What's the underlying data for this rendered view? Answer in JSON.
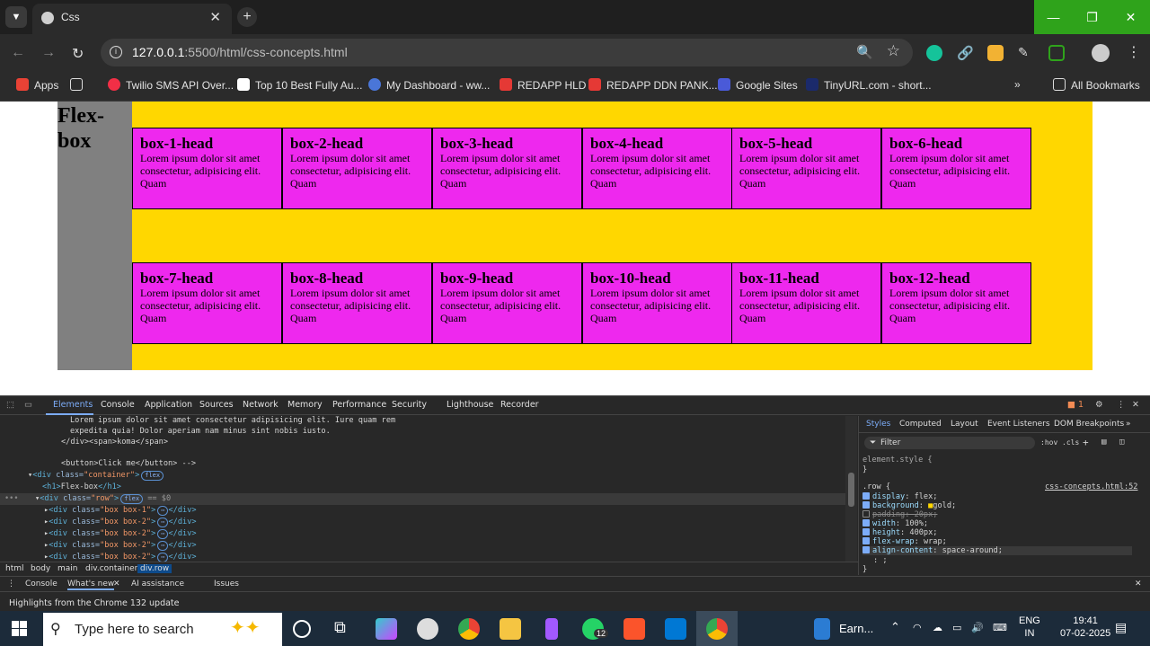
{
  "browser": {
    "tab_title": "Css",
    "url_host": "127.0.0.1",
    "url_path": ":5500/html/css-concepts.html",
    "bookmarks": [
      {
        "label": "Apps",
        "color": "#e94235"
      },
      {
        "label": "Twilio SMS API Over...",
        "color": "#f22f46"
      },
      {
        "label": "Top 10 Best Fully Au...",
        "color": "#ffffff"
      },
      {
        "label": "My Dashboard - ww...",
        "color": "#4a76d8"
      },
      {
        "label": "REDAPP HLD",
        "color": "#e53935"
      },
      {
        "label": "REDAPP DDN PANK...",
        "color": "#e53935"
      },
      {
        "label": "Google Sites",
        "color": "#4a5ad8"
      },
      {
        "label": "TinyURL.com - short...",
        "color": "#1b2a6b"
      }
    ],
    "all_bookmarks": "All Bookmarks"
  },
  "page": {
    "heading": "Flex-box",
    "boxes": [
      {
        "head": "box-1-head",
        "text": "Lorem ipsum dolor sit amet consectetur, adipisicing elit. Quam"
      },
      {
        "head": "box-2-head",
        "text": "Lorem ipsum dolor sit amet consectetur, adipisicing elit. Quam"
      },
      {
        "head": "box-3-head",
        "text": "Lorem ipsum dolor sit amet consectetur, adipisicing elit. Quam"
      },
      {
        "head": "box-4-head",
        "text": "Lorem ipsum dolor sit amet consectetur, adipisicing elit. Quam"
      },
      {
        "head": "box-5-head",
        "text": "Lorem ipsum dolor sit amet consectetur, adipisicing elit. Quam"
      },
      {
        "head": "box-6-head",
        "text": "Lorem ipsum dolor sit amet consectetur, adipisicing elit. Quam"
      },
      {
        "head": "box-7-head",
        "text": "Lorem ipsum dolor sit amet consectetur, adipisicing elit. Quam"
      },
      {
        "head": "box-8-head",
        "text": "Lorem ipsum dolor sit amet consectetur, adipisicing elit. Quam"
      },
      {
        "head": "box-9-head",
        "text": "Lorem ipsum dolor sit amet consectetur, adipisicing elit. Quam"
      },
      {
        "head": "box-10-head",
        "text": "Lorem ipsum dolor sit amet consectetur, adipisicing elit. Quam"
      },
      {
        "head": "box-11-head",
        "text": "Lorem ipsum dolor sit amet consectetur, adipisicing elit. Quam"
      },
      {
        "head": "box-12-head",
        "text": "Lorem ipsum dolor sit amet consectetur, adipisicing elit. Quam"
      }
    ],
    "colors": {
      "container_bg": "#ffd700",
      "heading_bg": "#808080",
      "box_bg": "#ee28ee"
    }
  },
  "devtools": {
    "tabs": [
      "Elements",
      "Console",
      "Application",
      "Sources",
      "Network",
      "Memory",
      "Performance",
      "Security",
      "Lighthouse",
      "Recorder"
    ],
    "issue_count": "1",
    "code": {
      "l1": "Lorem ipsum dolor sit amet consectetur adipisicing elit. Iure quam rem",
      "l2": "expedita quia! Dolor aperiam nam minus sint nobis iusto.",
      "l3": "</div><span>koma</span>",
      "l4": "<button>Click me</button> -->",
      "container_class": "container",
      "h1_text": "Flex-box",
      "row_class": "row",
      "flex_pill": "flex",
      "selected_marker": "== $0",
      "children": [
        "box box-1",
        "box box-2",
        "box box-2",
        "box box-2",
        "box box-2"
      ]
    },
    "breadcrumbs": [
      "html",
      "body",
      "main",
      "div.container",
      "div.row"
    ],
    "styles_tabs": [
      "Styles",
      "Computed",
      "Layout",
      "Event Listeners",
      "DOM Breakpoints"
    ],
    "filter_placeholder": "Filter",
    "hov": ":hov",
    "cls": ".cls",
    "element_style": "element.style {",
    "rule_selector": ".row {",
    "rule_source": "css-concepts.html:52",
    "declarations": [
      {
        "prop": "display",
        "value": "flex;",
        "enabled": true
      },
      {
        "prop": "background",
        "value": "gold;",
        "enabled": true
      },
      {
        "prop": "padding",
        "value": "20px;",
        "enabled": false
      },
      {
        "prop": "width",
        "value": "100%;",
        "enabled": true
      },
      {
        "prop": "height",
        "value": "400px;",
        "enabled": true
      },
      {
        "prop": "flex-wrap",
        "value": "wrap;",
        "enabled": true
      },
      {
        "prop": "align-content",
        "value": "space-around;",
        "enabled": true
      }
    ],
    "drawer_tabs": [
      "Console",
      "What's new",
      "AI assistance",
      "Issues"
    ],
    "drawer_message": "Highlights from the Chrome 132 update"
  },
  "taskbar": {
    "search_placeholder": "Type here to search",
    "task_label": "Earn...",
    "whatsapp_badge": "12",
    "lang": "ENG",
    "lang_region": "IN",
    "time": "19:41",
    "date": "07-02-2025"
  }
}
